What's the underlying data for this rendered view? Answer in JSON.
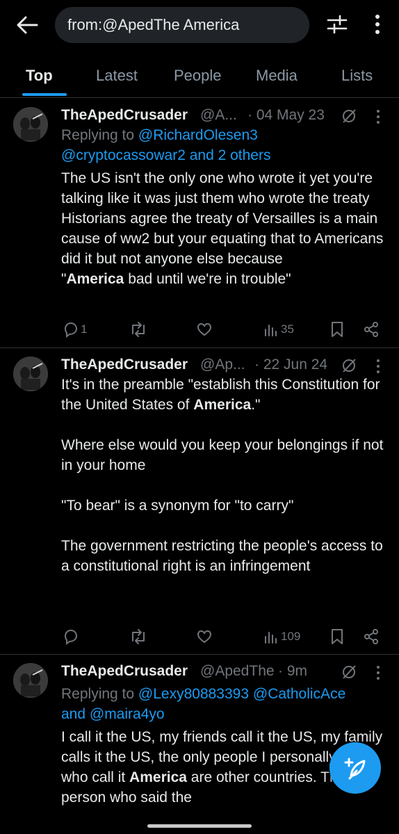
{
  "header": {
    "search_value": "from:@ApedThe America",
    "back_icon": "arrow-left-icon",
    "filter_icon": "sliders-icon",
    "more_icon": "more-vertical-icon"
  },
  "tabs": [
    {
      "label": "Top",
      "active": true
    },
    {
      "label": "Latest",
      "active": false
    },
    {
      "label": "People",
      "active": false
    },
    {
      "label": "Media",
      "active": false
    },
    {
      "label": "Lists",
      "active": false
    }
  ],
  "colors": {
    "accent": "#1d9bf0",
    "background": "#000000",
    "text": "#e7e9ea",
    "muted": "#71767b",
    "divider": "#2f3336"
  },
  "tweets": [
    {
      "name": "TheApedCrusader",
      "handle": "@A...",
      "date": "· 04 May 23",
      "reply_prefix": "Replying to",
      "reply_mention_1": "@RichardOlesen3",
      "reply_mention_2": "@cryptocassowar2 and 2 others",
      "lines": {
        "l1": "The US isn't the only one who wrote it yet you're talking like it was just them who wrote the treaty",
        "l2": "Historians agree the treaty of Versailles is a main cause of ww2 but your equating that to Americans did it but not anyone else because",
        "l3_pre": "\"",
        "l3_bold": "America",
        "l3_post": " bad until we're in trouble\""
      },
      "replies": "1",
      "reposts": "",
      "likes": "",
      "views": "35"
    },
    {
      "name": "TheApedCrusader",
      "handle": "@Ap...",
      "date": "· 22 Jun 24",
      "lines": {
        "p1_pre": "It's in the preamble \"establish this Constitution for the United States of ",
        "p1_bold": "America",
        "p1_post": ".\"",
        "p2": "Where else would you keep your belongings if not in your home",
        "p3": "\"To bear\" is a synonym for \"to carry\"",
        "p4": "The government restricting the people's access to a constitutional right is an infringement"
      },
      "replies": "",
      "reposts": "",
      "likes": "",
      "views": "109"
    },
    {
      "name": "TheApedCrusader",
      "handle": "@ApedThe",
      "date": "· 9m",
      "reply_prefix": "Replying to",
      "reply_mention_1": "@Lexy80883393",
      "reply_mention_2": "@CatholicAce",
      "reply_mention_3": "and @maira4yo",
      "lines": {
        "t_pre": "I call it the US, my friends call it the US, my family calls it the US, the only people I personally know who call it ",
        "t_bold": "America",
        "t_post": " are other countries. The only person who said the"
      }
    }
  ],
  "fab": {
    "icon": "compose-plus-icon"
  }
}
